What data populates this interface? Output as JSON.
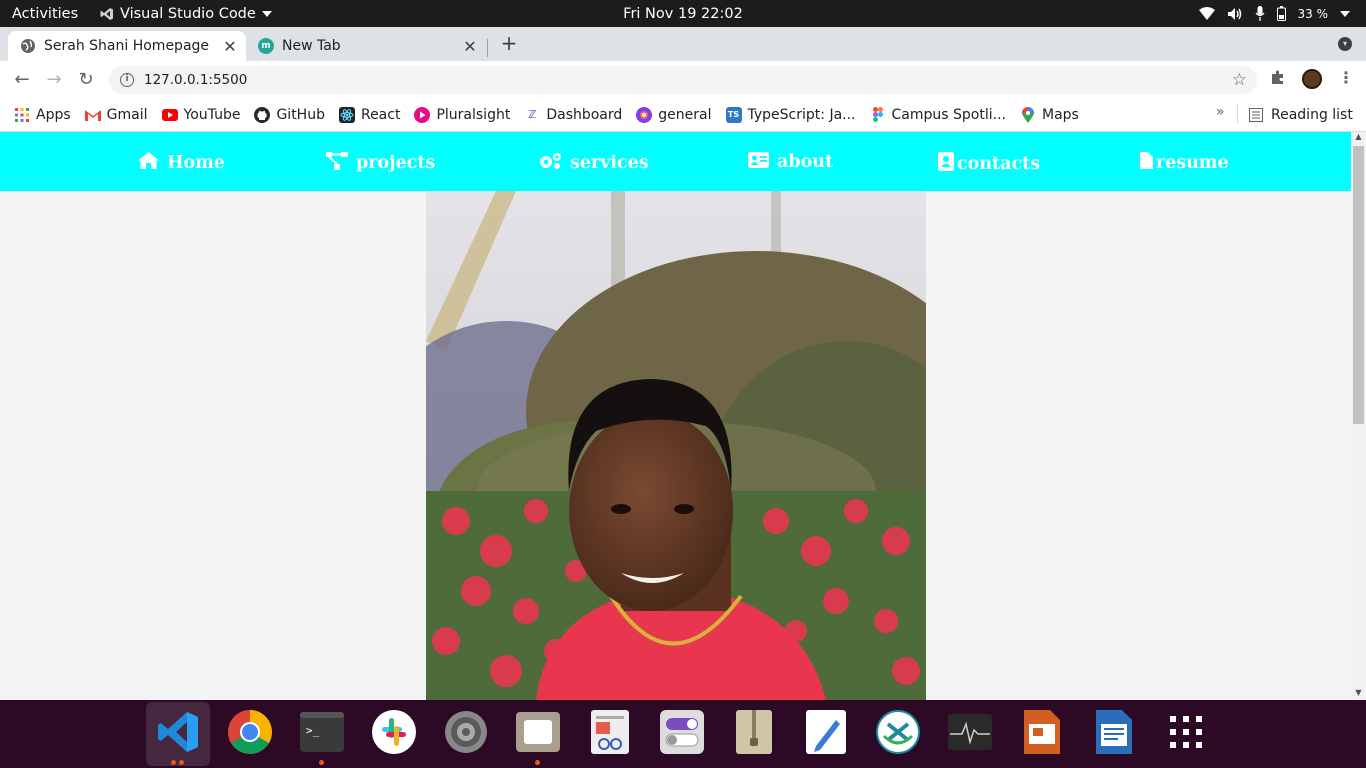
{
  "topbar": {
    "activities": "Activities",
    "app_name": "Visual Studio Code",
    "clock": "Fri Nov 19  22:02",
    "battery": "33 %"
  },
  "tabs": [
    {
      "title": "Serah Shani Homepage",
      "active": true,
      "favicon_color": "#5f6368"
    },
    {
      "title": "New Tab",
      "active": false,
      "favicon_color": "#26a69a"
    }
  ],
  "toolbar": {
    "url": "127.0.0.1:5500"
  },
  "bookmarks": {
    "items": [
      {
        "label": "Apps",
        "icon": "apps-grid-icon",
        "color": "#ea4335"
      },
      {
        "label": "Gmail",
        "icon": "gmail-icon",
        "color": "#ea4335"
      },
      {
        "label": "YouTube",
        "icon": "youtube-icon",
        "color": "#ff0000"
      },
      {
        "label": "GitHub",
        "icon": "github-icon",
        "color": "#24292e"
      },
      {
        "label": "React",
        "icon": "react-icon",
        "color": "#20232a"
      },
      {
        "label": "Pluralsight",
        "icon": "pluralsight-icon",
        "color": "#f15b2a"
      },
      {
        "label": "Dashboard",
        "icon": "dashboard-icon",
        "color": "#5a4fcf"
      },
      {
        "label": "general",
        "icon": "general-icon",
        "color": "#7e3ff2"
      },
      {
        "label": "TypeScript: Ja...",
        "icon": "typescript-icon",
        "color": "#3178c6"
      },
      {
        "label": "Campus Spotli...",
        "icon": "figma-icon",
        "color": "#f24e1e"
      },
      {
        "label": "Maps",
        "icon": "maps-pin-icon",
        "color": "#34a853"
      }
    ],
    "more": "»",
    "reading_list": "Reading list"
  },
  "site": {
    "nav_bg": "#00ffff",
    "nav": [
      {
        "label": "Home",
        "icon": "home-icon"
      },
      {
        "label": "projects",
        "icon": "sitemap-icon"
      },
      {
        "label": "services",
        "icon": "cogs-icon"
      },
      {
        "label": "about",
        "icon": "id-card-icon"
      },
      {
        "label": "contacts",
        "icon": "contact-card-icon"
      },
      {
        "label": "resume",
        "icon": "file-icon"
      }
    ]
  },
  "dock": {
    "items": [
      {
        "name": "vscode",
        "running": true
      },
      {
        "name": "chrome",
        "running": false
      },
      {
        "name": "terminal",
        "running": true
      },
      {
        "name": "slack",
        "running": false
      },
      {
        "name": "settings",
        "running": false
      },
      {
        "name": "files",
        "running": true
      },
      {
        "name": "document-viewer",
        "running": false
      },
      {
        "name": "tweaks",
        "running": false
      },
      {
        "name": "archive-manager",
        "running": false
      },
      {
        "name": "text-editor",
        "running": false
      },
      {
        "name": "remote-desktop",
        "running": false
      },
      {
        "name": "system-monitor",
        "running": false
      },
      {
        "name": "impress",
        "running": false
      },
      {
        "name": "writer",
        "running": false
      },
      {
        "name": "show-applications",
        "running": false
      }
    ]
  }
}
